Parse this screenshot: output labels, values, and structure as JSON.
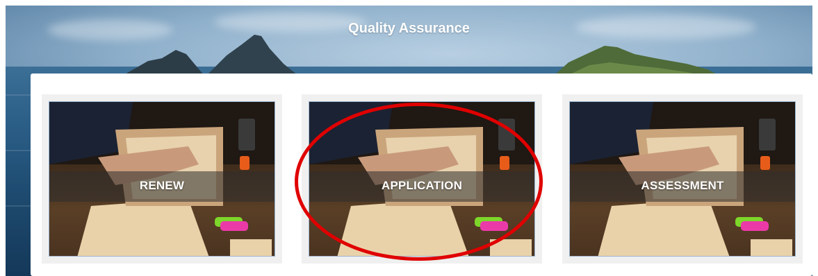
{
  "header": {
    "title": "Quality Assurance"
  },
  "cards": [
    {
      "label": "RENEW"
    },
    {
      "label": "APPLICATION"
    },
    {
      "label": "ASSESSMENT"
    }
  ],
  "annotation": {
    "shape": "ellipse",
    "color": "#e00000",
    "target": "APPLICATION"
  }
}
